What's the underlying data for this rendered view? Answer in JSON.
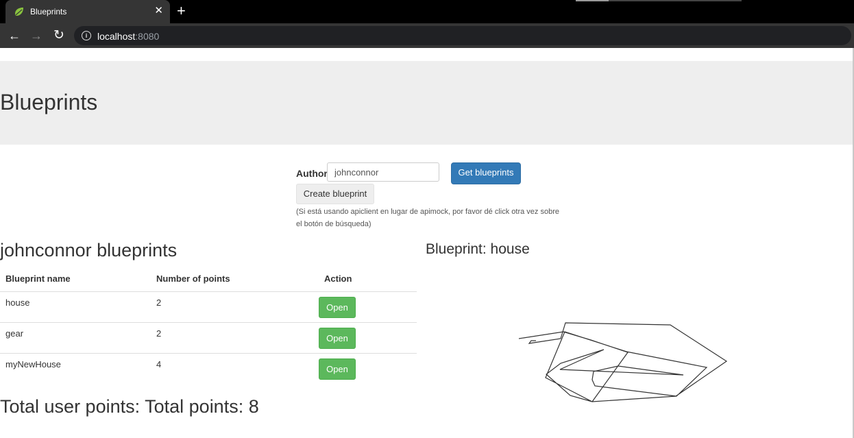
{
  "browser": {
    "tab_title": "Blueprints",
    "tab_close": "✕",
    "new_tab": "+",
    "url_host": "localhost",
    "url_port": ":8080",
    "nav_back": "←",
    "nav_forward": "→",
    "nav_reload": "↻"
  },
  "page": {
    "heading": "Blueprints"
  },
  "form": {
    "author_label": "Author",
    "author_value": "johnconnor",
    "get_button": "Get blueprints",
    "create_button": "Create blueprint",
    "help_text": "(Si está usando apiclient en lugar de apimock, por favor dé click otra vez sobre el botón de búsqueda)"
  },
  "list": {
    "title": "johnconnor blueprints",
    "columns": [
      "Blueprint name",
      "Number of points",
      "Action"
    ],
    "rows": [
      {
        "name": "house",
        "points": "2",
        "action": "Open"
      },
      {
        "name": "gear",
        "points": "2",
        "action": "Open"
      },
      {
        "name": "myNewHouse",
        "points": "4",
        "action": "Open"
      }
    ],
    "total": "Total user points: Total points: 8"
  },
  "canvas": {
    "title": "Blueprint: house"
  }
}
